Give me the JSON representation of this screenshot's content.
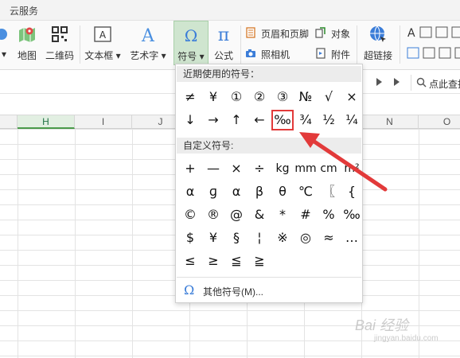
{
  "topbar": {
    "tab": "云服务"
  },
  "ribbon": {
    "map": "地图",
    "qrcode": "二维码",
    "textbox": "文本框",
    "wordart": "艺术字",
    "symbol": "符号",
    "formula": "公式",
    "header_footer": "页眉和页脚",
    "object": "对象",
    "camera": "照相机",
    "attachment": "附件",
    "hyperlink": "超链接",
    "caret": "▾"
  },
  "search": {
    "label": "点此查找"
  },
  "columns": [
    "H",
    "I",
    "J",
    "N",
    "O"
  ],
  "popup": {
    "recent_title": "近期使用的符号：",
    "recent": [
      "≠",
      "¥",
      "①",
      "②",
      "③",
      "№",
      "√",
      "×",
      "↓",
      "→",
      "↑",
      "←",
      "‰",
      "¾",
      "½",
      "¼"
    ],
    "custom_title": "自定义符号:",
    "custom": [
      "+",
      "—",
      "×",
      "÷",
      "kg",
      "mm",
      "cm",
      "m²",
      "α",
      "ɡ",
      "α",
      "β",
      "θ",
      "℃",
      "〖",
      "{",
      "©",
      "®",
      "@",
      "&",
      "*",
      "#",
      "%",
      "‰",
      "$",
      "¥",
      "§",
      "¦",
      "※",
      "◎",
      "≈",
      "…",
      "≤",
      "≥",
      "≦",
      "≧"
    ],
    "more": "其他符号(M)...",
    "omega": "Ω"
  },
  "watermark": {
    "main": "Bai 经验",
    "sub": "jingyan.baidu.com"
  },
  "colors": {
    "highlight": "#e23a3a",
    "accent_green": "#4a9a4a",
    "accent_blue": "#3b7dd8"
  }
}
